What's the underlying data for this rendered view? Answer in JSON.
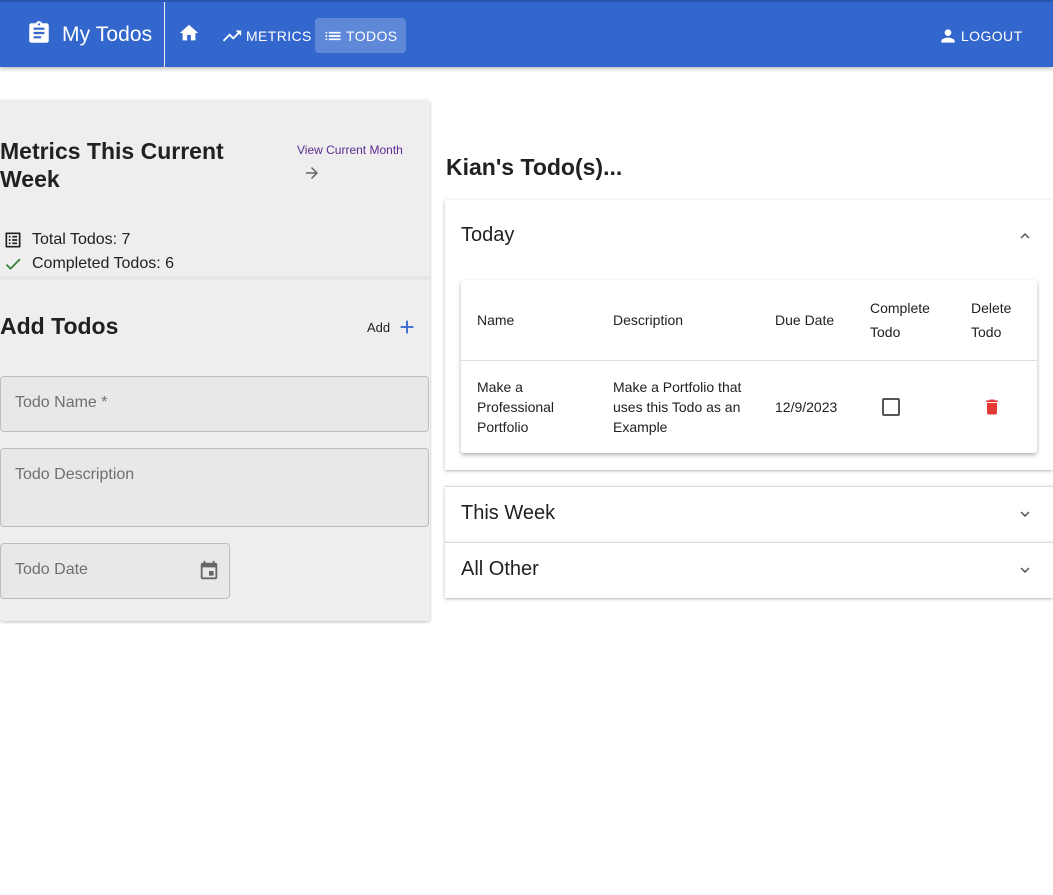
{
  "appbar": {
    "title": "My Todos",
    "nav": {
      "home_icon": "home-icon",
      "metrics_label": "METRICS",
      "todos_label": "TODOS"
    },
    "logout_label": "LOGOUT",
    "colors": {
      "bar": "#3367cd",
      "active_tab": "#5c86da"
    }
  },
  "metrics": {
    "title": "Metrics This Current Week",
    "view_link": "View Current Month",
    "total_label": "Total Todos: 7",
    "completed_label": "Completed Todos: 6"
  },
  "add_todos": {
    "title": "Add Todos",
    "add_label": "Add",
    "fields": {
      "name_label": "Todo Name *",
      "description_label": "Todo Description",
      "date_label": "Todo Date"
    }
  },
  "todos": {
    "heading": "Kian's Todo(s)...",
    "sections": {
      "today": "Today",
      "this_week": "This Week",
      "all_other": "All Other"
    },
    "table": {
      "headers": {
        "name": "Name",
        "description": "Description",
        "due_date": "Due Date",
        "complete": "Complete Todo",
        "delete": "Delete Todo"
      },
      "rows": [
        {
          "name": "Make a Professional Portfolio",
          "description": "Make a Portfolio that uses this Todo as an Example",
          "due_date": "12/9/2023",
          "complete": false
        }
      ]
    }
  },
  "colors": {
    "delete_icon": "#e53935",
    "check_icon": "#2e7d32",
    "link": "#5c2d91"
  }
}
